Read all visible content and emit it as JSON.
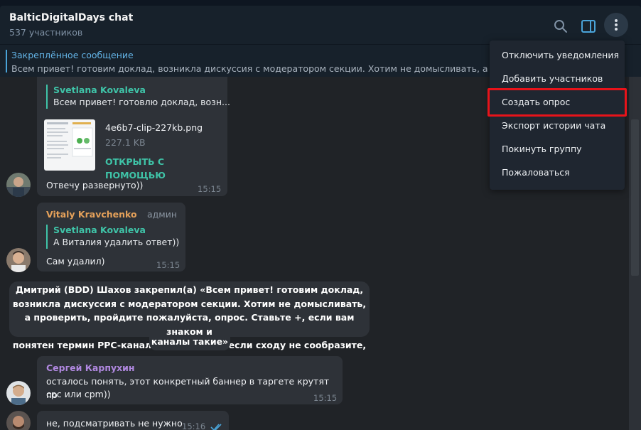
{
  "header": {
    "title": "BalticDigitalDays chat",
    "subtitle": "537 участников",
    "icons": [
      "search-icon",
      "sidebar-toggle-icon",
      "more-vertical-icon"
    ]
  },
  "pinned": {
    "title": "Закреплённое сообщение",
    "text": "Всем привет! готовим доклад, возникла дискуссия с модератором секции. Хотим не домысливать, а проверить"
  },
  "messages": {
    "m1": {
      "reply_name": "Svetlana Kovaleva",
      "reply_text": "Всем привет! готовлю доклад, возн...",
      "file_name": "4e6b7-clip-227kb.png",
      "file_size": "227.1 KB",
      "file_action": "ОТКРЫТЬ С ПОМОЩЬЮ",
      "text": "Отвечу развернуто))",
      "time": "15:15"
    },
    "m2": {
      "sender": "Vitaly Kravchenko",
      "role": "админ",
      "reply_name": "Svetlana Kovaleva",
      "reply_text": "А Виталия удалить ответ))",
      "text": "Сам удалил)",
      "time": "15:15"
    },
    "service": {
      "line1": "Дмитрий (BDD) Шахов закрепил(а) «Всем привет! готовим доклад,",
      "line2": "возникла дискуссия с модератором секции. Хотим не домысливать,",
      "line3": "а проверить, пройдите пожалуйста, опрос. Ставьте +, если вам знаком и",
      "line4": "понятен  термин PPC-каналы. И - (минус), если сходу не сообразите, что за",
      "line5": "каналы такие»"
    },
    "m3": {
      "sender": "Сергей Карпухин",
      "line1": "осталось понять, этот конкретный баннер в таргете крутят по",
      "line2": "cpc или cpm))",
      "time": "15:15"
    },
    "m4": {
      "text": "не, подсматривать не нужно",
      "time": "15:16"
    }
  },
  "menu": {
    "items": [
      {
        "label": "Отключить уведомления"
      },
      {
        "label": "Добавить участников"
      },
      {
        "label": "Создать опрос"
      },
      {
        "label": "Экспорт истории чата"
      },
      {
        "label": "Покинуть группу"
      },
      {
        "label": "Пожаловаться"
      }
    ]
  },
  "colors": {
    "accent": "#64b5e8",
    "reply_name": "#3fc4a8",
    "sender_vitaly": "#e5a15a",
    "sender_sergey": "#b088e0",
    "highlight": "#e8131a"
  }
}
